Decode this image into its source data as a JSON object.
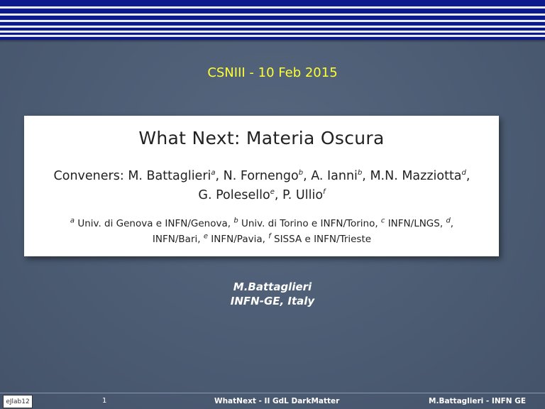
{
  "header": {
    "event": "CSNIII - 10 Feb 2015"
  },
  "paper": {
    "title": "What Next: Materia Oscura",
    "conveners_label": "Conveners:",
    "authors": [
      {
        "name": "M. Battaglieri",
        "aff": "a",
        "sep": ", "
      },
      {
        "name": "N. Fornengo",
        "aff": "b",
        "sep": ", "
      },
      {
        "name": "A. Ianni",
        "aff": "b",
        "sep": ", "
      },
      {
        "name": "M.N. Mazziotta",
        "aff": "d",
        "sep": ","
      },
      {
        "name": "G. Polesello",
        "aff": "e",
        "sep": ", "
      },
      {
        "name": "P. Ullio",
        "aff": "f",
        "sep": ""
      }
    ],
    "affiliations": [
      {
        "mark": "a",
        "text": "Univ. di Genova e INFN/Genova",
        "sep": ", "
      },
      {
        "mark": "b",
        "text": "Univ. di Torino e INFN/Torino",
        "sep": ", "
      },
      {
        "mark": "c",
        "text": "INFN/LNGS",
        "sep": ", "
      },
      {
        "mark": "d",
        "text": "INFN/Bari",
        "sep": ", "
      },
      {
        "mark": "e",
        "text": "INFN/Pavia",
        "sep": ", "
      },
      {
        "mark": "f",
        "text": "SISSA e INFN/Trieste",
        "sep": ""
      }
    ]
  },
  "speaker": {
    "name": "M.Battaglieri",
    "institution": "INFN-GE, Italy"
  },
  "footer": {
    "logo_text": "eJlab12",
    "page_number": "1",
    "center_text": "WhatNext - II GdL DarkMatter",
    "right_text": "M.Battaglieri - INFN GE"
  },
  "colors": {
    "background": "#4c5c74",
    "stripes": "#0c1a8c",
    "title_accent": "#ffff33"
  }
}
